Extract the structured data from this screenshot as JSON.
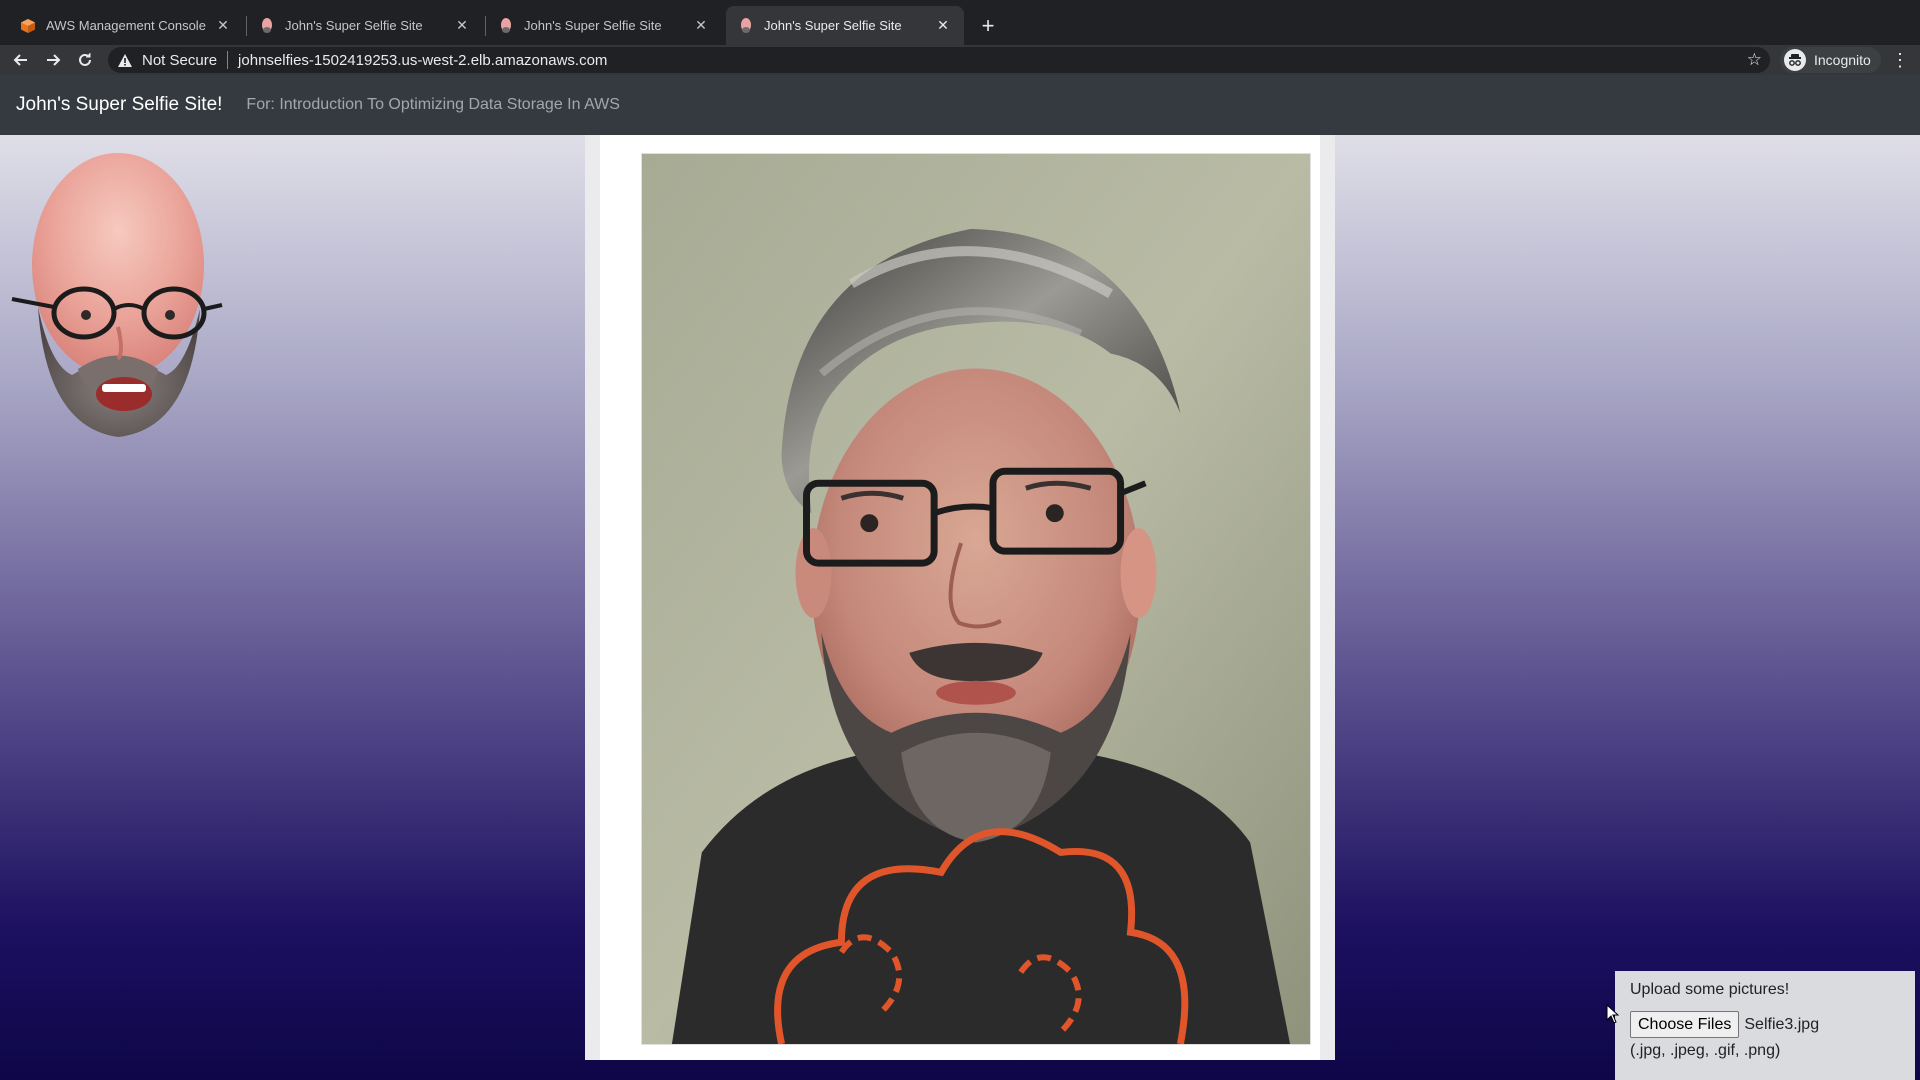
{
  "browser": {
    "tabs": [
      {
        "label": "AWS Management Console",
        "icon": "aws-cube-icon",
        "active": false
      },
      {
        "label": "John's Super Selfie Site",
        "icon": "selfie-favicon",
        "active": false
      },
      {
        "label": "John's Super Selfie Site",
        "icon": "selfie-favicon",
        "active": false
      },
      {
        "label": "John's Super Selfie Site",
        "icon": "selfie-favicon",
        "active": true
      }
    ],
    "security_label": "Not Secure",
    "url": "johnselfies-1502419253.us-west-2.elb.amazonaws.com",
    "profile_label": "Incognito"
  },
  "site": {
    "brand": "John's Super Selfie Site!",
    "subtitle": "For: Introduction To Optimizing Data Storage In AWS"
  },
  "upload": {
    "title": "Upload some pictures!",
    "button_label": "Choose Files",
    "selected_file": "Selfie3.jpg",
    "accepted_types": "(.jpg, .jpeg, .gif, .png)"
  },
  "colors": {
    "navbar": "#343a40",
    "chrome_dark": "#202124",
    "tshirt_logo": "#e0562a"
  }
}
